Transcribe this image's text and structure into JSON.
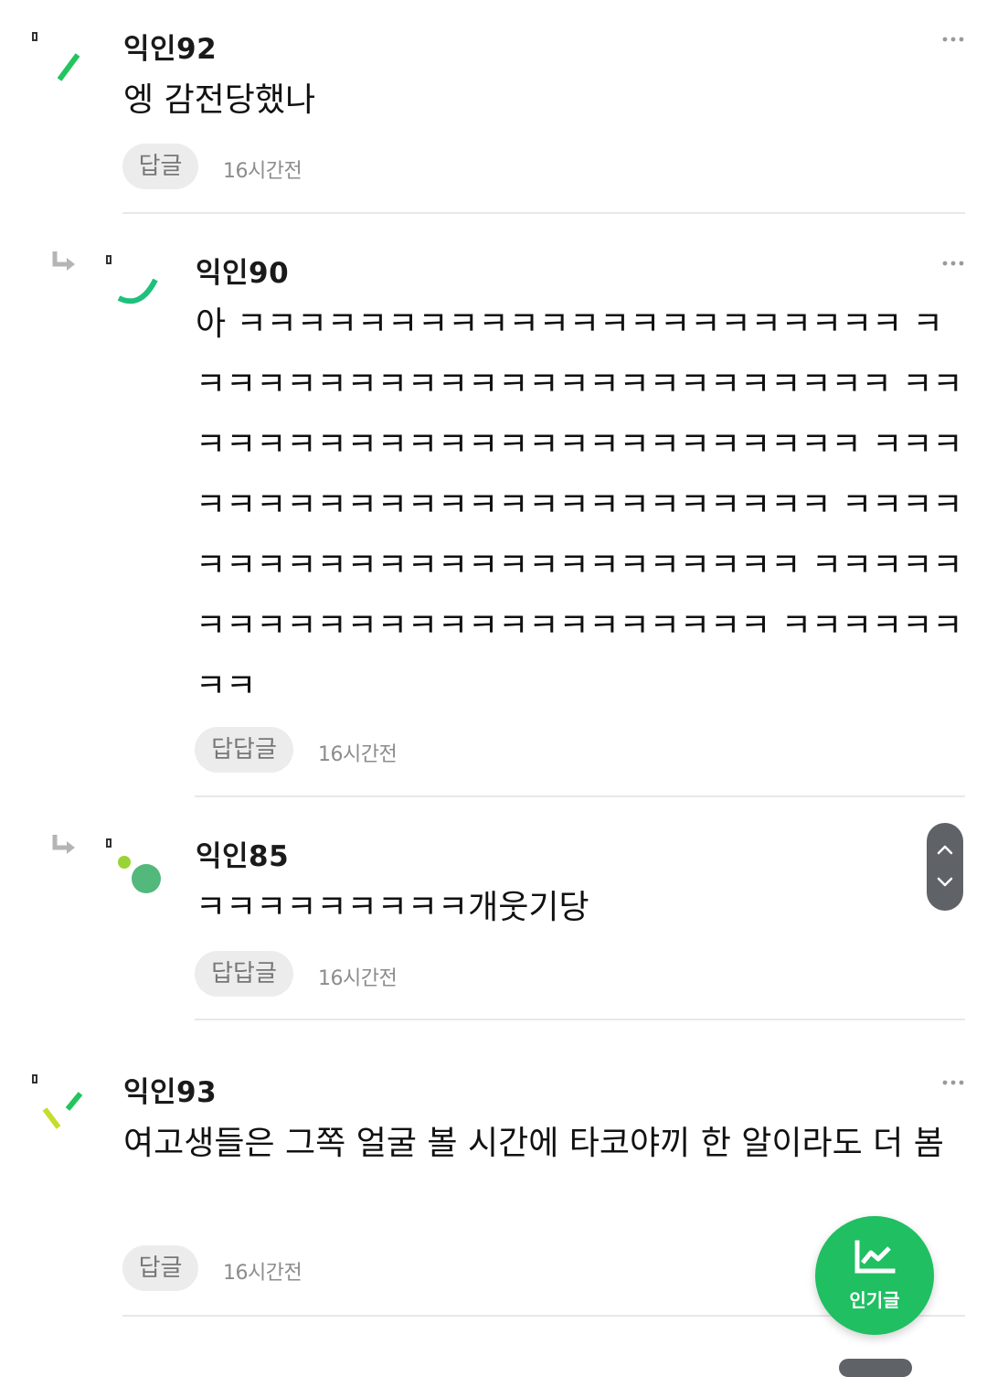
{
  "comments": [
    {
      "nick": "익인92",
      "text": "엥 감전당했나",
      "reply_label": "답글",
      "time": "16시간전"
    },
    {
      "nick": "익인90",
      "text": "아 ㅋㅋㅋㅋㅋㅋㅋㅋㅋㅋㅋㅋㅋㅋㅋㅋㅋㅋㅋㅋㅋㅋ ㅋㅋㅋㅋㅋㅋㅋㅋㅋㅋㅋㅋㅋㅋㅋㅋㅋㅋㅋㅋㅋㅋㅋㅋ ㅋㅋㅋㅋㅋㅋㅋㅋㅋㅋㅋㅋㅋㅋㅋㅋㅋㅋㅋㅋㅋㅋㅋㅋ ㅋㅋㅋㅋㅋㅋㅋㅋㅋㅋㅋㅋㅋㅋㅋㅋㅋㅋㅋㅋㅋㅋㅋㅋ ㅋㅋㅋㅋㅋㅋㅋㅋㅋㅋㅋㅋㅋㅋㅋㅋㅋㅋㅋㅋㅋㅋㅋㅋ ㅋㅋㅋㅋㅋㅋㅋㅋㅋㅋㅋㅋㅋㅋㅋㅋㅋㅋㅋㅋㅋㅋㅋㅋ ㅋㅋㅋㅋㅋㅋㅋㅋ",
      "reply_label": "답답글",
      "time": "16시간전"
    },
    {
      "nick": "익인85",
      "text": "ㅋㅋㅋㅋㅋㅋㅋㅋㅋ개웃기당",
      "reply_label": "답답글",
      "time": "16시간전"
    },
    {
      "nick": "익인93",
      "text": "여고생들은 그쪽 얼굴 볼 시간에 타코야끼 한 알이라도 더 봄",
      "reply_label": "답글",
      "time": "16시간전"
    }
  ],
  "fab": {
    "label": "인기글",
    "icon": "trending-chart-icon",
    "color": "#1fbf62"
  },
  "scroll_buttons": {
    "up_icon": "chevron-up-icon",
    "down_icon": "chevron-down-icon"
  },
  "colors": {
    "accent": "#1fbf62",
    "reply_bg": "#ececec",
    "divider": "#e8e8e8"
  }
}
